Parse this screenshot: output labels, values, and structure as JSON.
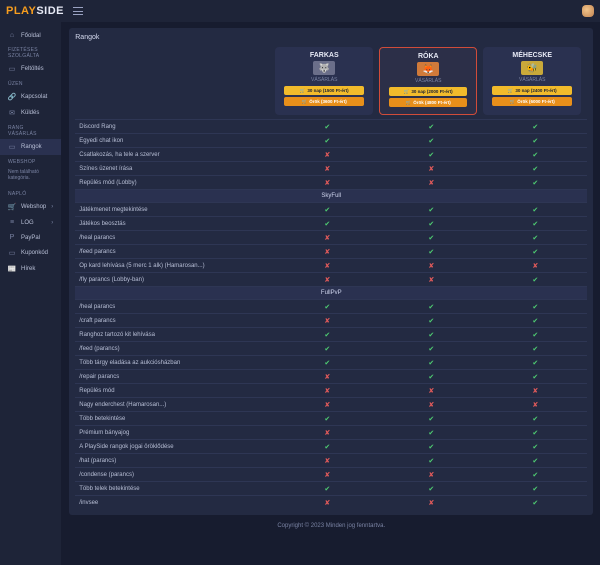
{
  "brand": {
    "p1": "PLAY",
    "p2": "SIDE"
  },
  "sidebar": {
    "home": "Főoldal",
    "h1": "FIZETÉSES SZOLGÁLTA",
    "i1": "Feltöltés",
    "h2": "ÜZEN",
    "i2": "Kapcsolat",
    "i3": "Küldés",
    "h3": "RANG VÁSÁRLÁS",
    "i4": "Rangok",
    "h4": "WEBSHOP",
    "i4msg": "Nem található kategória.",
    "h5": "NAPLÓ",
    "i5": "Webshop",
    "i6": "LOG",
    "i7": "PayPal",
    "i8": "Kuponkód",
    "i9": "Hírek"
  },
  "page": {
    "title": "Rangok"
  },
  "plans": [
    {
      "name": "FARKAS",
      "sub": "VÁSÁRLÁS",
      "b1": "30 nap (1500 Ft-ért)",
      "b2": "Örök (3600 Ft-ért)"
    },
    {
      "name": "RÓKA",
      "sub": "VÁSÁRLÁS",
      "b1": "30 nap (2000 Ft-ért)",
      "b2": "Örök (4800 Ft-ért)"
    },
    {
      "name": "MÉHECSKE",
      "sub": "VÁSÁRLÁS",
      "b1": "30 nap (2400 Ft-ért)",
      "b2": "Örök (6000 Ft-ért)"
    }
  ],
  "sections": {
    "s1": "SkyFull",
    "s2": "FullPvP"
  },
  "rows": [
    {
      "l": "Discord Rang",
      "v": [
        "c",
        "c",
        "c"
      ]
    },
    {
      "l": "Egyedi chat ikon",
      "v": [
        "c",
        "c",
        "c"
      ]
    },
    {
      "l": "Csatlakozás, ha tele a szerver",
      "v": [
        "x",
        "c",
        "c"
      ]
    },
    {
      "l": "Színes üzenet írása",
      "v": [
        "x",
        "x",
        "c"
      ]
    },
    {
      "l": "Repülés mód (Lobby)",
      "v": [
        "x",
        "x",
        "c"
      ]
    },
    {
      "sec": "s1"
    },
    {
      "l": "Játékmenet megtekintése",
      "v": [
        "c",
        "c",
        "c"
      ]
    },
    {
      "l": "Játékos beosztás",
      "v": [
        "c",
        "c",
        "c"
      ]
    },
    {
      "l": "/heal parancs",
      "v": [
        "x",
        "c",
        "c"
      ]
    },
    {
      "l": "/feed parancs",
      "v": [
        "x",
        "c",
        "c"
      ]
    },
    {
      "l": "Op kard lehívása (5 merc 1 alk) (Hamarosan...)",
      "v": [
        "x",
        "x",
        "x"
      ]
    },
    {
      "l": "/fly parancs (Lobby-ban)",
      "v": [
        "x",
        "x",
        "c"
      ]
    },
    {
      "sec": "s2"
    },
    {
      "l": "/heal parancs",
      "v": [
        "c",
        "c",
        "c"
      ]
    },
    {
      "l": "/craft parancs",
      "v": [
        "x",
        "c",
        "c"
      ]
    },
    {
      "l": "Ranghoz tartozó kit lehívása",
      "v": [
        "c",
        "c",
        "c"
      ]
    },
    {
      "l": "/feed (parancs)",
      "v": [
        "c",
        "c",
        "c"
      ]
    },
    {
      "l": "Több tárgy eladása az aukciósházban",
      "v": [
        "c",
        "c",
        "c"
      ]
    },
    {
      "l": "/repair parancs",
      "v": [
        "x",
        "c",
        "c"
      ]
    },
    {
      "l": "Repülés mód",
      "v": [
        "x",
        "x",
        "x"
      ]
    },
    {
      "l": "Nagy enderchest (Hamarosan...)",
      "v": [
        "x",
        "x",
        "x"
      ]
    },
    {
      "l": "Több betekintése",
      "v": [
        "c",
        "c",
        "c"
      ]
    },
    {
      "l": "Prémium bányajog",
      "v": [
        "x",
        "c",
        "c"
      ]
    },
    {
      "l": "A PlaySide rangok jogai öröklődése",
      "v": [
        "c",
        "c",
        "c"
      ]
    },
    {
      "l": "/hat (parancs)",
      "v": [
        "x",
        "c",
        "c"
      ]
    },
    {
      "l": "/condense (parancs)",
      "v": [
        "x",
        "x",
        "c"
      ]
    },
    {
      "l": "Több telek betekintése",
      "v": [
        "c",
        "c",
        "c"
      ]
    },
    {
      "l": "/invsee",
      "v": [
        "x",
        "x",
        "c"
      ]
    }
  ],
  "footer": "Copyright © 2023 Minden jog fenntartva."
}
